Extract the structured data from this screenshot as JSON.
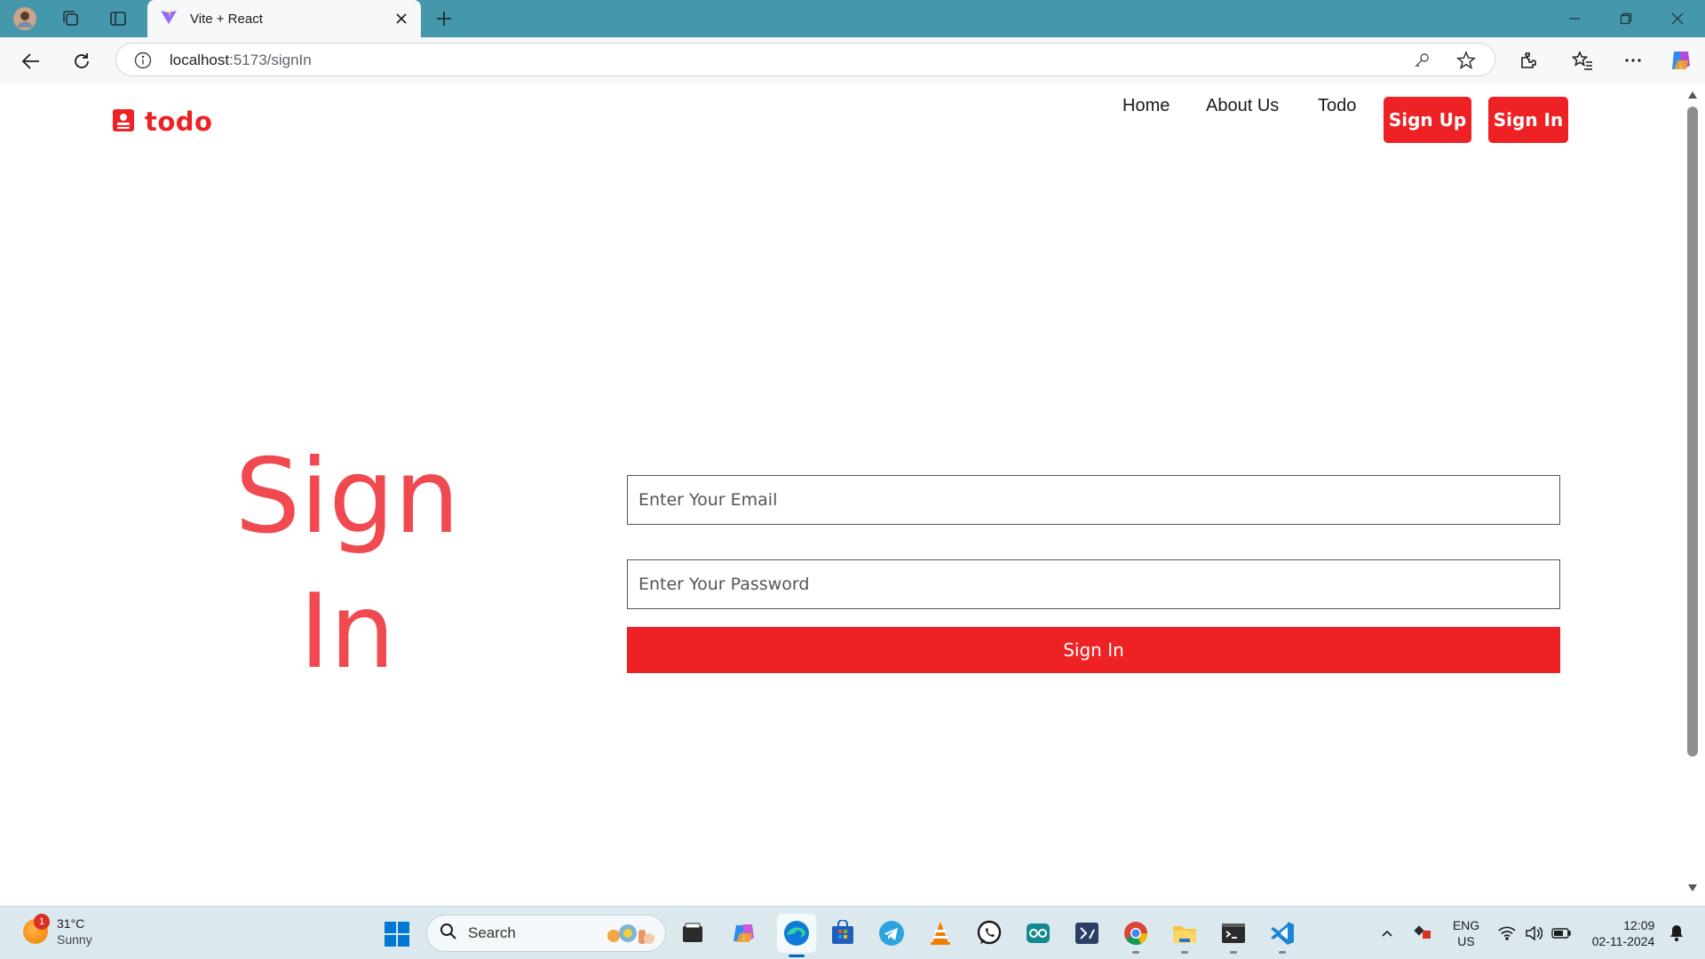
{
  "browser": {
    "tab_title": "Vite + React",
    "url_host": "localhost",
    "url_path": ":5173/signIn",
    "icons": [
      "profile-avatar-icon",
      "workspaces-icon",
      "tab-actions-icon",
      "vite-favicon-icon",
      "close-icon",
      "new-tab-icon",
      "minimize-icon",
      "restore-icon",
      "window-close-icon",
      "back-icon",
      "refresh-icon",
      "site-info-icon",
      "password-key-icon",
      "favorite-star-icon",
      "extensions-icon",
      "favorites-icon",
      "more-icon",
      "copilot-icon"
    ]
  },
  "site": {
    "logo_text": "todo",
    "nav": {
      "home": "Home",
      "about": "About Us",
      "todo": "Todo",
      "signup": "Sign Up",
      "signin": "Sign In"
    },
    "hero_line1": "Sign",
    "hero_line2": "In",
    "email_placeholder": "Enter Your Email",
    "password_placeholder": "Enter Your Password",
    "submit_label": "Sign In",
    "accent_color": "#ee2124",
    "hero_color": "#f04a50"
  },
  "taskbar": {
    "weather_temp": "31°C",
    "weather_desc": "Sunny",
    "weather_badge": "1",
    "search_label": "Search",
    "language_line1": "ENG",
    "language_line2": "US",
    "time": "12:09",
    "date": "02-11-2024",
    "apps": [
      "file-manager",
      "copilot",
      "edge",
      "microsoft-store",
      "telegram",
      "vlc",
      "whatsapp",
      "arduino",
      "terminal-app",
      "chrome",
      "file-explorer",
      "command-prompt",
      "vscode"
    ]
  }
}
